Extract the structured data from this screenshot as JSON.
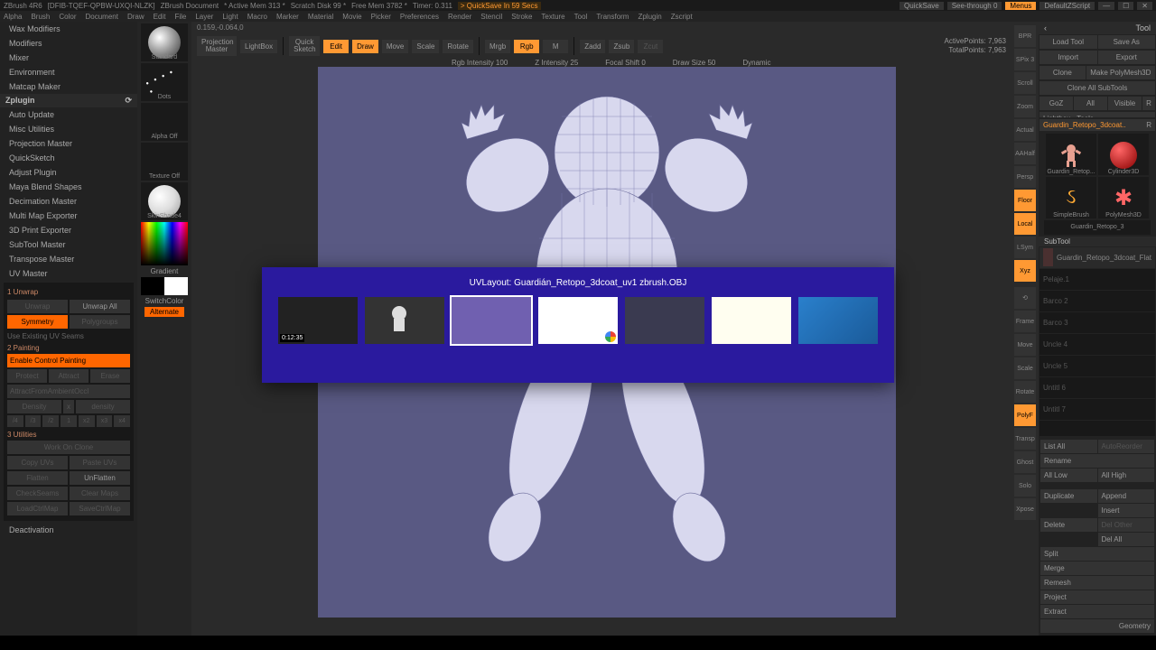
{
  "topbar": {
    "product": "ZBrush 4R6",
    "doc_id": "[DFIB-TQEF-QPBW-UXQI-NLZK]",
    "doc_label": "ZBrush Document",
    "active_mem": "* Active Mem 313 *",
    "scratch": "Scratch Disk 99 *",
    "free_mem": "Free Mem 3782 *",
    "timer": "Timer: 0.311",
    "quicksave_msg": "> QuickSave In 59 Secs",
    "quicksave_btn": "QuickSave",
    "seethrough": "See-through  0",
    "menus_btn": "Menus",
    "script": "DefaultZScript"
  },
  "menu": [
    "Alpha",
    "Brush",
    "Color",
    "Document",
    "Draw",
    "Edit",
    "File",
    "Layer",
    "Light",
    "Macro",
    "Marker",
    "Material",
    "Movie",
    "Picker",
    "Preferences",
    "Render",
    "Stencil",
    "Stroke",
    "Texture",
    "Tool",
    "Transform",
    "Zplugin",
    "Zscript"
  ],
  "left": {
    "items_top": [
      "Wax Modifiers",
      "Modifiers",
      "Mixer",
      "Environment",
      "Matcap Maker"
    ],
    "zplugin_header": "Zplugin",
    "items_plugins": [
      "Auto Update",
      "Misc Utilities",
      "Projection Master",
      "QuickSketch",
      "Adjust Plugin",
      "Maya Blend Shapes",
      "Decimation Master",
      "Multi Map Exporter",
      "3D Print Exporter",
      "SubTool Master",
      "Transpose Master",
      "UV Master"
    ],
    "uv": {
      "unwrap_header": "1 Unwrap",
      "unwrap": "Unwrap",
      "unwrap_all": "Unwrap All",
      "symmetry": "Symmetry",
      "polygroups": "Polygroups",
      "use_existing": "Use Existing UV Seams",
      "painting_header": "2 Painting",
      "enable_cp": "Enable Control Painting",
      "protect": "Protect",
      "attract": "Attract",
      "erase": "Erase",
      "attract_amb": "AttractFromAmbientOccl",
      "density": "Density",
      "x": "x",
      "density2": "density",
      "nums": [
        "/4",
        "/3",
        "/2",
        "1",
        "x2",
        "x3",
        "x4"
      ],
      "util_header": "3 Utilities",
      "work_clone": "Work On Clone",
      "copy": "Copy UVs",
      "paste": "Paste UVs",
      "flatten": "Flatten",
      "unflatten": "UnFlatten",
      "checkseams": "CheckSeams",
      "clearmaps": "Clear Maps",
      "loadctrl": "LoadCtrlMap",
      "savectrl": "SaveCtrlMap"
    },
    "deactivation": "Deactivation"
  },
  "brushcol": {
    "standard": "Standard",
    "dots": "Dots",
    "alpha_off": "Alpha Off",
    "texture_off": "Texture Off",
    "skinshade4": "SkinShade4",
    "gradient": "Gradient",
    "switchcolor": "SwitchColor",
    "alternate": "Alternate"
  },
  "ctoolbar": {
    "proj_master": "Projection\nMaster",
    "lightbox": "LightBox",
    "quicksketch_lbl": "Quick\nSketch",
    "edit": "Edit",
    "draw": "Draw",
    "move": "Move",
    "scale": "Scale",
    "rotate": "Rotate",
    "mrgb": "Mrgb",
    "rgb": "Rgb",
    "m": "M",
    "zadd": "Zadd",
    "zsub": "Zsub",
    "zcut": "Zcut",
    "rgb_intensity": "Rgb Intensity 100",
    "z_intensity": "Z Intensity 25",
    "focal_shift": "Focal Shift 0",
    "draw_size": "Draw Size 50",
    "dynamic": "Dynamic",
    "active_points": "ActivePoints: 7,963",
    "total_points": "TotalPoints: 7,963",
    "coord": "0.159,-0.064,0"
  },
  "vsidebar": {
    "bpr": "BPR",
    "spix": "SPix 3",
    "scroll": "Scroll",
    "zoom": "Zoom",
    "actual": "Actual",
    "aahalf": "AAHalf",
    "persp": "Persp",
    "floor": "Floor",
    "local": "Local",
    "lsym": "LSym",
    "xyz": "Xyz",
    "frame": "Frame",
    "move": "Move",
    "scale": "Scale",
    "rotate": "Rotate",
    "polyf": "PolyF",
    "transp": "Transp",
    "ghost": "Ghost",
    "solo": "Solo",
    "xpose": "Xpose"
  },
  "right": {
    "tool_header": "Tool",
    "load_tool": "Load Tool",
    "save_as": "Save As",
    "import": "Import",
    "export": "Export",
    "clone": "Clone",
    "make_poly": "Make PolyMesh3D",
    "clone_all": "Clone All SubTools",
    "goz": "GoZ",
    "all": "All",
    "visible": "Visible",
    "r": "R",
    "lightbox_tools": "Lightbox › Tools",
    "current_tool": "Guardin_Retopo_3dcoat..",
    "tools": [
      "Guardin_Retop...",
      "Cylinder3D",
      "SimpleBrush",
      "PolyMesh3D",
      "Guardin_Retopo_3"
    ],
    "subtool_header": "SubTool",
    "subtools": [
      "Guardin_Retopo_3dcoat_Flat",
      "Pelaje.1",
      "Barco 2",
      "Barco 3",
      "Uncle 4",
      "Uncle 5",
      "Untitl 6",
      "Untitl 7"
    ],
    "list_all": "List All",
    "autoreorder": "AutoReorder",
    "rename": "Rename",
    "all_low": "All Low",
    "all_high": "All High",
    "duplicate": "Duplicate",
    "append": "Append",
    "insert": "Insert",
    "delete": "Delete",
    "del_other": "Del Other",
    "del_all": "Del All",
    "split": "Split",
    "merge": "Merge",
    "remesh": "Remesh",
    "project": "Project",
    "extract": "Extract",
    "geometry": "Geometry"
  },
  "alttab": {
    "title": "UVLayout: Guardián_Retopo_3dcoat_uv1 zbrush.OBJ",
    "thumbs": [
      {
        "bg": "#222",
        "label": "0:12:35"
      },
      {
        "bg": "#333"
      },
      {
        "bg": "#7060b0",
        "sel": true
      },
      {
        "bg": "#fff"
      },
      {
        "bg": "#3a3a50"
      },
      {
        "bg": "#fffef0"
      },
      {
        "bg": "#2a80cc"
      }
    ]
  }
}
